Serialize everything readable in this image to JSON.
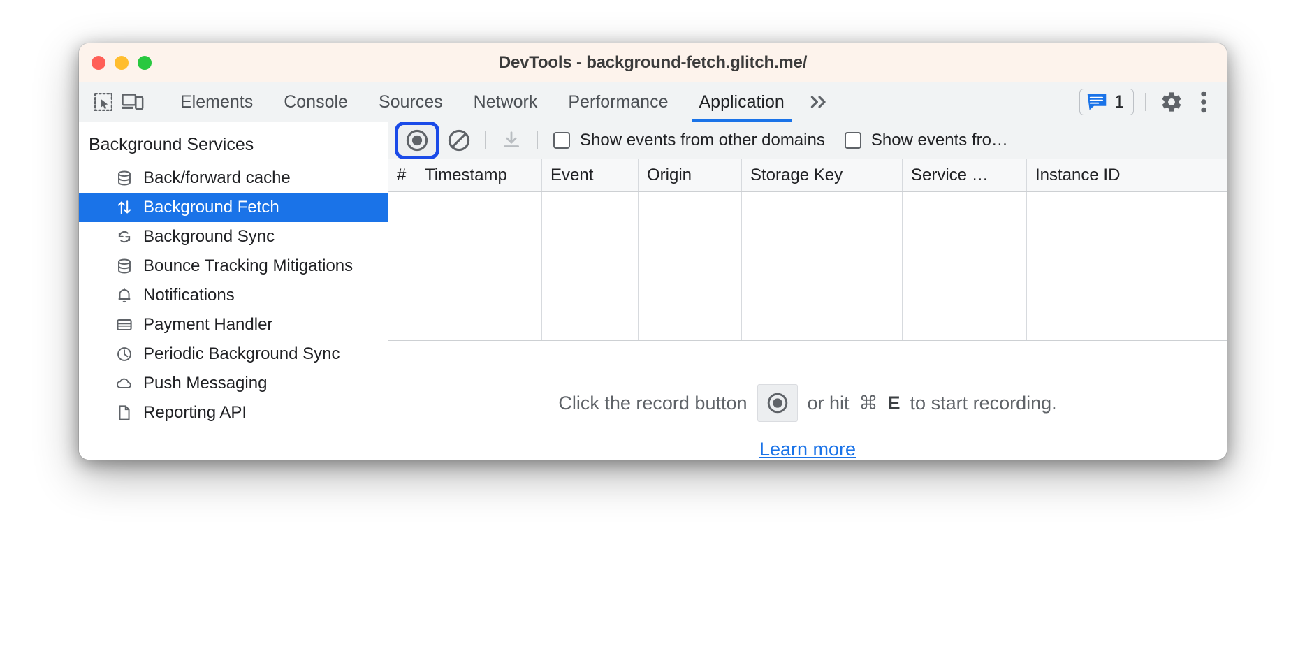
{
  "window": {
    "title": "DevTools - background-fetch.glitch.me/",
    "traffic_lights": [
      "close",
      "minimize",
      "maximize"
    ]
  },
  "tabbar": {
    "left_icons": [
      "inspect-element-icon",
      "device-toolbar-icon"
    ],
    "tabs": [
      {
        "label": "Elements",
        "active": false
      },
      {
        "label": "Console",
        "active": false
      },
      {
        "label": "Sources",
        "active": false
      },
      {
        "label": "Network",
        "active": false
      },
      {
        "label": "Performance",
        "active": false
      },
      {
        "label": "Application",
        "active": true
      }
    ],
    "more_tabs_icon": "chevron-double-right-icon",
    "message_count": "1",
    "settings_icon": "gear-icon",
    "menu_icon": "more-vertical-icon"
  },
  "sidebar": {
    "section_title": "Background Services",
    "items": [
      {
        "label": "Back/forward cache",
        "icon": "database-icon",
        "selected": false
      },
      {
        "label": "Background Fetch",
        "icon": "arrows-up-down-icon",
        "selected": true
      },
      {
        "label": "Background Sync",
        "icon": "sync-icon",
        "selected": false
      },
      {
        "label": "Bounce Tracking Mitigations",
        "icon": "database-icon",
        "selected": false
      },
      {
        "label": "Notifications",
        "icon": "bell-icon",
        "selected": false
      },
      {
        "label": "Payment Handler",
        "icon": "credit-card-icon",
        "selected": false
      },
      {
        "label": "Periodic Background Sync",
        "icon": "clock-icon",
        "selected": false
      },
      {
        "label": "Push Messaging",
        "icon": "cloud-icon",
        "selected": false
      },
      {
        "label": "Reporting API",
        "icon": "document-icon",
        "selected": false
      }
    ]
  },
  "panel": {
    "toolbar": {
      "record_icon": "record-circle-icon",
      "record_focused": true,
      "clear_icon": "clear-ban-icon",
      "download_icon": "download-icon",
      "checkboxes": [
        {
          "label": "Show events from other domains",
          "checked": false
        },
        {
          "label": "Show events fro…",
          "checked": false
        }
      ]
    },
    "table": {
      "columns": [
        "#",
        "Timestamp",
        "Event",
        "Origin",
        "Storage Key",
        "Service …",
        "Instance ID"
      ],
      "rows": []
    },
    "empty_state": {
      "text_before": "Click the record button",
      "record_icon": "record-circle-icon",
      "text_middle": "or hit",
      "kbd_modifier": "⌘",
      "kbd_key": "E",
      "text_after": "to start recording.",
      "link": "Learn more"
    }
  },
  "colors": {
    "accent": "#1a73e8",
    "focus_ring": "#1a4ae8",
    "titlebar_bg": "#fdf3ec",
    "toolbar_bg": "#f1f3f4"
  }
}
